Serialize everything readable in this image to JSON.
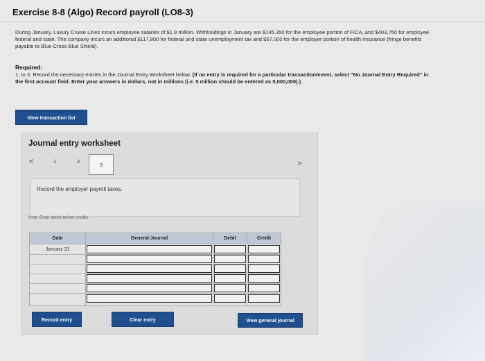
{
  "exercise": {
    "title": "Exercise 8-8 (Algo) Record payroll (LO8-3)"
  },
  "description": "During January, Luxury Cruise Lines incurs employee salaries of $1.9 million. Withholdings in January are $145,350 for the employee portion of FICA, and $403,750 for employee federal and state. The company incurs an additional $117,800 for federal and state unemployment tax and $57,000 for the employer portion of health insurance (fringe benefits payable to Blue Cross Blue Shield).",
  "required": {
    "label": "Required:",
    "text_lead": "1. to 3. Record the necessary entries in the Journal Entry Worksheet below.",
    "text_bold": "(If no entry is required for a particular transaction/event, select \"No Journal Entry Required\" in the first account field. Enter your answers in dollars, not in millions (i.e. 5 million should be entered as 5,000,000).)"
  },
  "buttons": {
    "view_transaction_list": "View transaction list",
    "record_entry": "Record entry",
    "clear_entry": "Clear entry",
    "view_general_journal": "View general journal"
  },
  "worksheet": {
    "title": "Journal entry worksheet",
    "nav_prev": "<",
    "nav_next": ">",
    "pages": [
      "1",
      "2",
      "3"
    ],
    "instruction": "Record the employer payroll taxes.",
    "note": "Note: Enter debits before credits."
  },
  "journal": {
    "columns": {
      "date": "Date",
      "general_journal": "General Journal",
      "debit": "Debit",
      "credit": "Credit"
    },
    "first_date": "January 31"
  },
  "colors": {
    "button": "#1f4f8f",
    "header_bg": "#bfc8d6"
  }
}
